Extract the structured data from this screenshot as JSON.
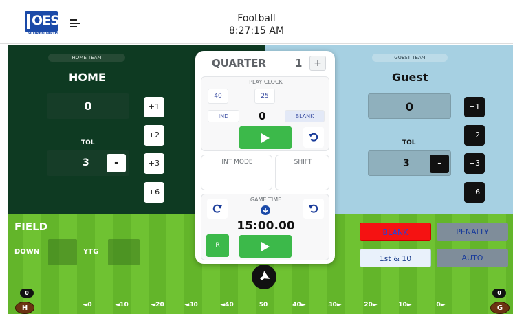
{
  "header": {
    "logo_text": "OES",
    "logo_sub": "SCOREBOARDS",
    "title": "Football",
    "time": "8:27:15 AM"
  },
  "home": {
    "tag": "HOME TEAM",
    "name": "HOME",
    "score": "0",
    "tol_label": "TOL",
    "tol_value": "3",
    "minus_label": "-",
    "inc_buttons": [
      "+1",
      "+2",
      "+3",
      "+6"
    ]
  },
  "guest": {
    "tag": "GUEST TEAM",
    "name": "Guest",
    "score": "0",
    "tol_label": "TOL",
    "tol_value": "3",
    "minus_label": "-",
    "inc_buttons": [
      "+1",
      "+2",
      "+3",
      "+6"
    ]
  },
  "center": {
    "quarter_label": "QUARTER",
    "quarter_value": "1",
    "quarter_plus": "+",
    "play_clock": {
      "caption": "PLAY CLOCK",
      "preset_40": "40",
      "preset_25": "25",
      "ind": "IND",
      "value": "0",
      "blank": "BLANK"
    },
    "int_mode": "INT MODE",
    "shift": "SHIFT",
    "game_time": {
      "caption": "GAME TIME",
      "value": "15:00.00",
      "r_label": "R"
    }
  },
  "field": {
    "label": "FIELD",
    "down_label": "DOWN",
    "ytg_label": "YTG",
    "flags": {
      "blank": "BLANK",
      "penalty": "PENALTY",
      "first_and_ten": "1st & 10",
      "auto": "AUTO"
    },
    "yard_markers": [
      "◄0",
      "◄10",
      "◄20",
      "◄30",
      "◄40",
      "50",
      "40►",
      "30►",
      "20►",
      "10►",
      "0►"
    ],
    "home_ball": {
      "score": "0",
      "letter": "H"
    },
    "guest_ball": {
      "score": "0",
      "letter": "G"
    }
  },
  "colors": {
    "home_panel": "#0e3a22",
    "guest_panel": "#a6d0e2",
    "field_green": "#63b52a",
    "play_green": "#3cb94a",
    "blank_red": "#f51212",
    "logo_blue": "#1b4aa8"
  },
  "icons": {
    "menu": "hamburger-menu-icon",
    "play": "play-icon",
    "undo": "undo-icon",
    "redo": "redo-icon",
    "down_arrow": "down-arrow-circle-icon",
    "horn": "horn-icon",
    "football": "football-icon"
  }
}
